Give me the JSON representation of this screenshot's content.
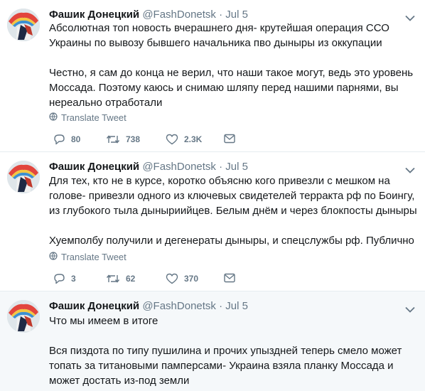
{
  "tweets": [
    {
      "name": "Фашик Донецкий",
      "handle": "@FashDonetsk",
      "dot": "·",
      "date": "Jul 5",
      "lines": [
        "Абсолютная топ новость вчерашнего дня- крутейшая операция ССО",
        "Украины по вывозу бывшего начальника пво дыныры из оккупации",
        "",
        "Честно, я сам до конца не верил, что наши такое могут, ведь это уровень",
        "Моссада. Поэтому каюсь и снимаю шляпу перед нашими парнями, вы",
        "нереально отработали"
      ],
      "translate_label": "Translate Tweet",
      "replies": "80",
      "retweets": "738",
      "likes": "2.3K"
    },
    {
      "name": "Фашик Донецкий",
      "handle": "@FashDonetsk",
      "dot": "·",
      "date": "Jul 5",
      "lines": [
        "Для тех, кто не в курсе, коротко объясню кого привезли с мешком на",
        "голове- привезли одного из ключевых свидетелей терракта рф по Боингу,",
        "из глубокого тыла дыныриийцев. Белым днём и через блокпосты дыныры",
        "",
        "Хуемполбу получили и дегенераты дыныры, и спецслужбы рф. Публично"
      ],
      "translate_label": "Translate Tweet",
      "replies": "3",
      "retweets": "62",
      "likes": "370"
    },
    {
      "name": "Фашик Донецкий",
      "handle": "@FashDonetsk",
      "dot": "·",
      "date": "Jul 5",
      "lines": [
        "Что мы имеем в итоге",
        "",
        "Вся пиздота по типу пушилина и прочих упыздней теперь смело может",
        "топать за титановыми памперсами- Украина взяла планку Моссада и",
        "может достать из-под земли"
      ]
    }
  ],
  "icons": {
    "reply": "reply-icon",
    "retweet": "retweet-icon",
    "like": "heart-icon",
    "dm": "envelope-icon",
    "translate": "globe-icon",
    "caret": "chevron-down-icon",
    "avatar": "avatar"
  },
  "colors": {
    "text": "#14171a",
    "muted": "#657786",
    "highlight_bg": "#f5f8fa",
    "divider": "#e6ecf0"
  }
}
